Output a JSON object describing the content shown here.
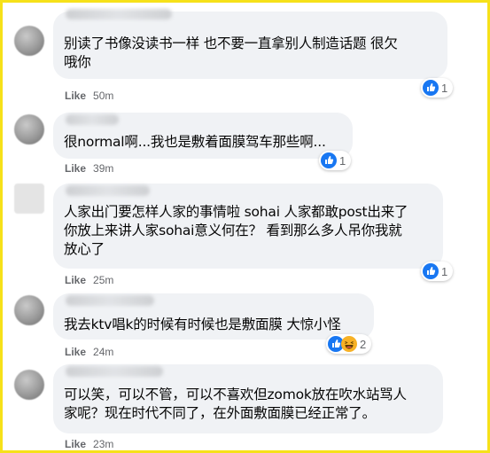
{
  "comments": [
    {
      "text_lines": [
        "别读了书像没读书一样 也不要一直拿别人制造话题 很欠",
        "哦你"
      ],
      "like_label": "Like",
      "time": "50m",
      "reactions": [
        "like"
      ],
      "reaction_count": "1"
    },
    {
      "text_lines": [
        "很normal啊...我也是敷着面膜驾车那些啊..."
      ],
      "like_label": "Like",
      "time": "39m",
      "reactions": [
        "like"
      ],
      "reaction_count": "1"
    },
    {
      "text_lines": [
        "人家出门要怎样人家的事情啦 sohai 人家都敢post出来了",
        "你放上来讲人家sohai意义何在？ 看到那么多人吊你我就",
        "放心了"
      ],
      "like_label": "Like",
      "time": "25m",
      "reactions": [
        "like"
      ],
      "reaction_count": "1"
    },
    {
      "text_lines": [
        "我去ktv唱k的时候有时候也是敷面膜 大惊小怪"
      ],
      "like_label": "Like",
      "time": "24m",
      "reactions": [
        "like",
        "haha"
      ],
      "reaction_count": "2"
    },
    {
      "text_lines": [
        "可以笑，可以不管，可以不喜欢但zomok放在吹水站骂人",
        "家呢？现在时代不同了，在外面敷面膜已经正常了。"
      ],
      "like_label": "Like",
      "time": "23m",
      "reactions": [],
      "reaction_count": ""
    }
  ],
  "colors": {
    "frame_border": "#f6e11a",
    "bubble_bg": "#f0f2f5",
    "like_blue": "#1877f2",
    "haha_yellow": "#f7b125",
    "meta_gray": "#65676b"
  }
}
